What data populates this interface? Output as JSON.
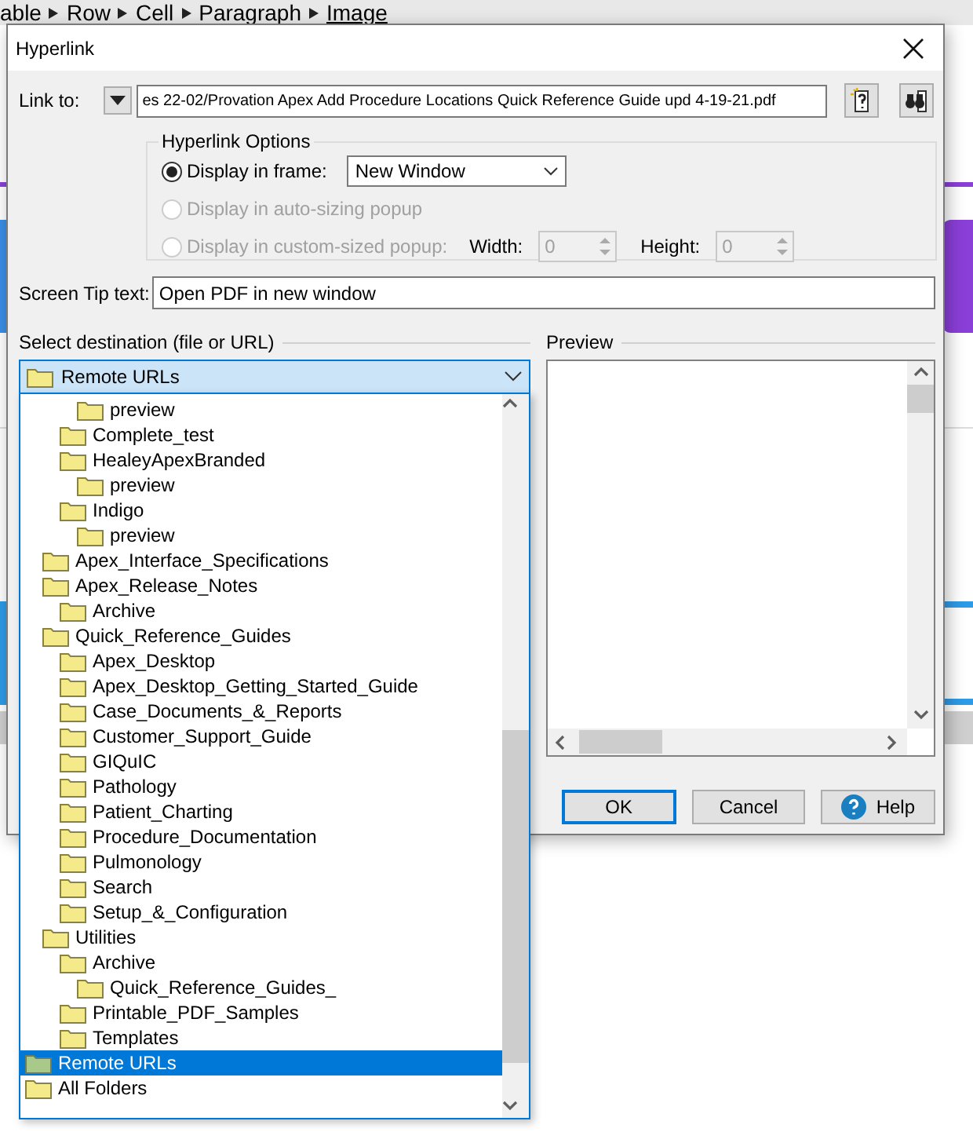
{
  "breadcrumb": [
    {
      "label": "able",
      "current": false
    },
    {
      "label": "Row",
      "current": false
    },
    {
      "label": "Cell",
      "current": false
    },
    {
      "label": "Paragraph",
      "current": false
    },
    {
      "label": "Image",
      "current": true
    }
  ],
  "dialog": {
    "title": "Hyperlink",
    "link_to": {
      "label": "Link to:",
      "value": "es 22-02/Provation Apex Add Procedure Locations Quick Reference Guide upd 4-19-21.pdf"
    },
    "options": {
      "title": "Hyperlink Options",
      "radios": [
        {
          "label": "Display in frame:",
          "selected": true,
          "disabled": false
        },
        {
          "label": "Display in auto-sizing popup",
          "selected": false,
          "disabled": true
        },
        {
          "label": "Display in custom-sized popup:",
          "selected": false,
          "disabled": true
        }
      ],
      "frame_select": "New Window",
      "width": {
        "label": "Width:",
        "value": "0",
        "disabled": true
      },
      "height": {
        "label": "Height:",
        "value": "0",
        "disabled": true
      }
    },
    "screen_tip": {
      "label": "Screen Tip text:",
      "value": "Open PDF in new window"
    },
    "destination": {
      "label": "Select destination (file or URL)",
      "value": "Remote URLs",
      "expanded": true,
      "tree": [
        {
          "children": [
            {
              "children": [
                {
                  "children": [
                    {
                      "label": "preview",
                      "selected": false
                    }
                  ]
                },
                {
                  "label": "Complete_test",
                  "selected": false
                },
                {
                  "label": "HealeyApexBranded",
                  "selected": false,
                  "children": [
                    {
                      "label": "preview",
                      "selected": false
                    }
                  ]
                },
                {
                  "label": "Indigo",
                  "selected": false,
                  "children": [
                    {
                      "label": "preview",
                      "selected": false
                    }
                  ]
                }
              ]
            },
            {
              "label": "Apex_Interface_Specifications",
              "selected": false
            },
            {
              "label": "Apex_Release_Notes",
              "selected": false,
              "children": [
                {
                  "label": "Archive",
                  "selected": false
                }
              ]
            },
            {
              "label": "Quick_Reference_Guides",
              "selected": false,
              "children": [
                {
                  "label": "Apex_Desktop",
                  "selected": false
                },
                {
                  "label": "Apex_Desktop_Getting_Started_Guide",
                  "selected": false
                },
                {
                  "label": "Case_Documents_&_Reports",
                  "selected": false
                },
                {
                  "label": "Customer_Support_Guide",
                  "selected": false
                },
                {
                  "label": "GIQuIC",
                  "selected": false
                },
                {
                  "label": "Pathology",
                  "selected": false
                },
                {
                  "label": "Patient_Charting",
                  "selected": false
                },
                {
                  "label": "Procedure_Documentation",
                  "selected": false
                },
                {
                  "label": "Pulmonology",
                  "selected": false
                },
                {
                  "label": "Search",
                  "selected": false
                },
                {
                  "label": "Setup_&_Configuration",
                  "selected": false
                }
              ]
            },
            {
              "label": "Utilities",
              "selected": false,
              "children": [
                {
                  "label": "Archive",
                  "selected": false,
                  "children": [
                    {
                      "label": "Quick_Reference_Guides_",
                      "selected": false
                    }
                  ]
                },
                {
                  "label": "Printable_PDF_Samples",
                  "selected": false
                },
                {
                  "label": "Templates",
                  "selected": false
                }
              ]
            }
          ]
        },
        {
          "label": "Remote URLs",
          "selected": true
        },
        {
          "label": "All Folders",
          "selected": false
        }
      ]
    },
    "preview": {
      "label": "Preview"
    },
    "buttons": [
      {
        "label": "OK",
        "kind": "default"
      },
      {
        "label": "Cancel",
        "kind": "plain"
      },
      {
        "label": "Help",
        "kind": "help"
      }
    ]
  }
}
